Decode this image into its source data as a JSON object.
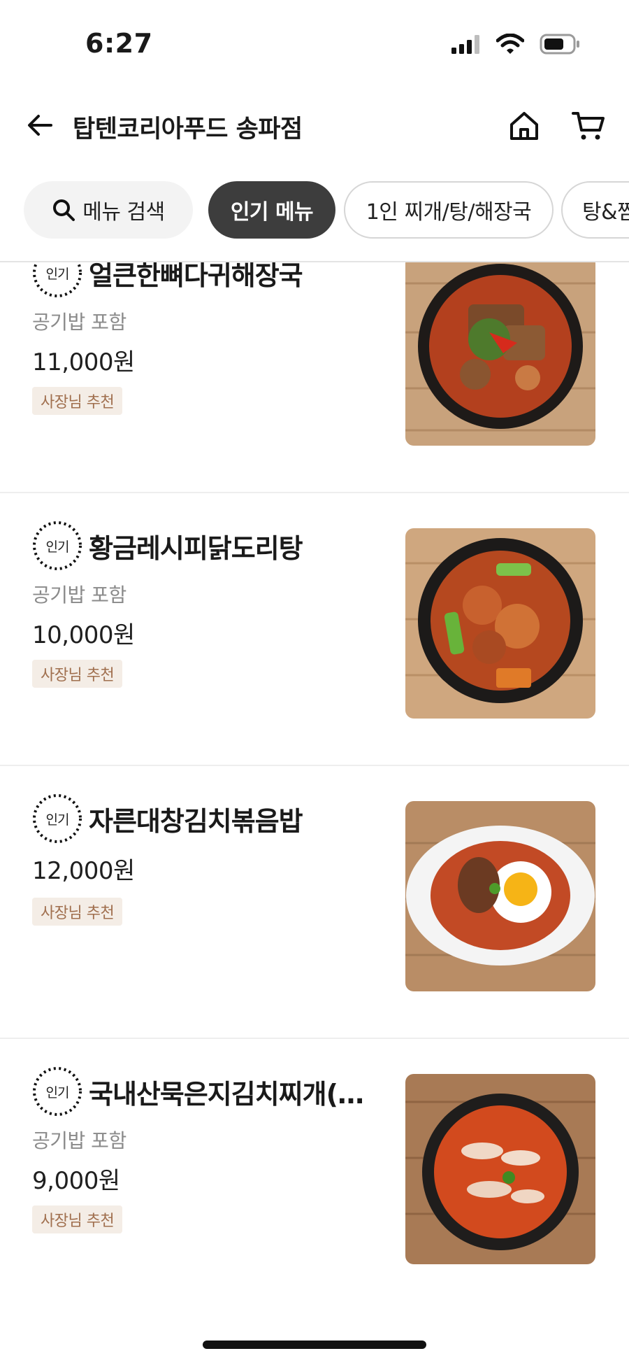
{
  "status_bar": {
    "time": "6:27"
  },
  "header": {
    "store_name": "탑텐코리아푸드 송파점"
  },
  "chips": {
    "search_label": "메뉴 검색",
    "items": [
      {
        "label": "인기 메뉴",
        "active": true
      },
      {
        "label": "1인 찌개/탕/해장국",
        "active": false
      },
      {
        "label": "탕&찜",
        "active": false
      }
    ]
  },
  "menu": {
    "popular_badge_text": "인기",
    "items": [
      {
        "name": "얼큰한뼈다귀해장국",
        "desc": "공기밥 포함",
        "price": "11,000원",
        "tag": "사장님 추천",
        "photo": "pork-bone-soup-photo"
      },
      {
        "name": "황금레시피닭도리탕",
        "desc": "공기밥 포함",
        "price": "10,000원",
        "tag": "사장님 추천",
        "photo": "spicy-chicken-stew-photo"
      },
      {
        "name": "자른대창김치볶음밥",
        "desc": "",
        "price": "12,000원",
        "tag": "사장님 추천",
        "photo": "kimchi-fried-rice-photo"
      },
      {
        "name": "국내산묵은지김치찌개(…",
        "desc": "공기밥 포함",
        "price": "9,000원",
        "tag": "사장님 추천",
        "photo": "kimchi-stew-photo"
      }
    ]
  },
  "colors": {
    "active_chip": "#3d3d3d",
    "tag_bg": "#f4ede6",
    "tag_text": "#a06f4e"
  }
}
